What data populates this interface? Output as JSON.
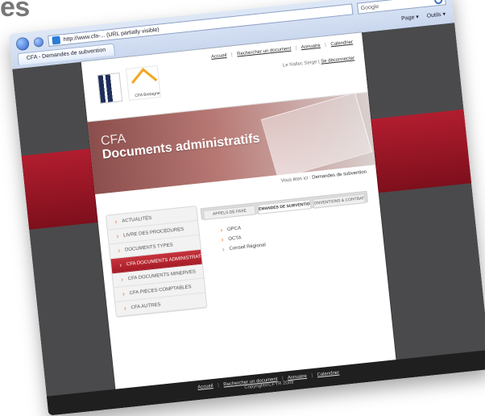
{
  "overlay": {
    "corner_title": "es"
  },
  "browser": {
    "address": "http://www.cfa-... (URL partially visible)",
    "search_placeholder": "Google",
    "tab_title": "CFA - Demandes de subvention",
    "toolbar": {
      "page": "Page ▾",
      "tools": "Outils ▾"
    }
  },
  "site": {
    "top_links": [
      "Accueil",
      "Rechercher un document",
      "Annuaire",
      "Calendrier"
    ],
    "user_prefix": "Le Nallec Serge |",
    "user_logout": "Se déconnecter",
    "hero": {
      "title": "CFA",
      "subtitle": "Documents administratifs"
    },
    "breadcrumb": {
      "prefix": "Vous êtes ici :",
      "current": "Demandes de subvention"
    },
    "logo_caption": "CFA Bretagne"
  },
  "sidebar": {
    "items": [
      {
        "label": "ACTUALITÉS"
      },
      {
        "label": "LIVRE DES PROCÉDURES"
      },
      {
        "label": "DOCUMENTS TYPES"
      },
      {
        "label": "CFA DOCUMENTS ADMINISTRATIFS"
      },
      {
        "label": "CFA DOCUMENTS MINERVES"
      },
      {
        "label": "CFA PIÈCES COMPTABLES"
      },
      {
        "label": "CFA AUTRES"
      }
    ]
  },
  "tabs": [
    {
      "label": "APPELS DE FAXE"
    },
    {
      "label": "DEMANDES DE SUBVENTION"
    },
    {
      "label": "CONVENTIONS & CONTRATS"
    }
  ],
  "links": [
    {
      "label": "OPCA"
    },
    {
      "label": "OCTA"
    },
    {
      "label": "Conseil Régional"
    }
  ],
  "footer": {
    "links": [
      "Accueil",
      "Rechercher un document",
      "Annuaire",
      "Calendrier"
    ],
    "copyright": "Copyright©CFYR 2009"
  }
}
